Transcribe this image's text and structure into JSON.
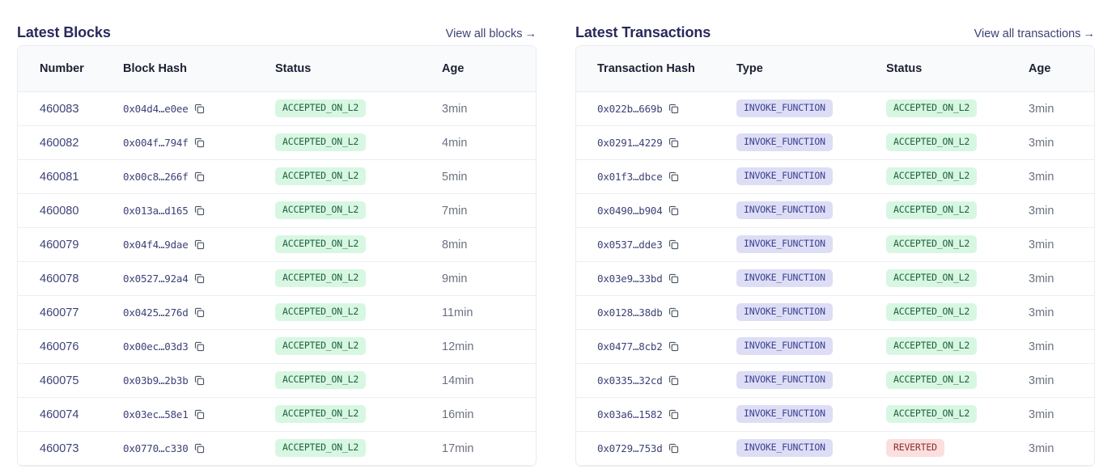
{
  "blocks_panel": {
    "title": "Latest Blocks",
    "view_all_label": "View all blocks",
    "view_all_arrow": "→",
    "columns": [
      "Number",
      "Block Hash",
      "Status",
      "Age"
    ],
    "rows": [
      {
        "number": "460083",
        "hash": "0x04d4…e0ee",
        "status": "ACCEPTED_ON_L2",
        "age": "3min"
      },
      {
        "number": "460082",
        "hash": "0x004f…794f",
        "status": "ACCEPTED_ON_L2",
        "age": "4min"
      },
      {
        "number": "460081",
        "hash": "0x00c8…266f",
        "status": "ACCEPTED_ON_L2",
        "age": "5min"
      },
      {
        "number": "460080",
        "hash": "0x013a…d165",
        "status": "ACCEPTED_ON_L2",
        "age": "7min"
      },
      {
        "number": "460079",
        "hash": "0x04f4…9dae",
        "status": "ACCEPTED_ON_L2",
        "age": "8min"
      },
      {
        "number": "460078",
        "hash": "0x0527…92a4",
        "status": "ACCEPTED_ON_L2",
        "age": "9min"
      },
      {
        "number": "460077",
        "hash": "0x0425…276d",
        "status": "ACCEPTED_ON_L2",
        "age": "11min"
      },
      {
        "number": "460076",
        "hash": "0x00ec…03d3",
        "status": "ACCEPTED_ON_L2",
        "age": "12min"
      },
      {
        "number": "460075",
        "hash": "0x03b9…2b3b",
        "status": "ACCEPTED_ON_L2",
        "age": "14min"
      },
      {
        "number": "460074",
        "hash": "0x03ec…58e1",
        "status": "ACCEPTED_ON_L2",
        "age": "16min"
      },
      {
        "number": "460073",
        "hash": "0x0770…c330",
        "status": "ACCEPTED_ON_L2",
        "age": "17min"
      }
    ]
  },
  "transactions_panel": {
    "title": "Latest Transactions",
    "view_all_label": "View all transactions",
    "view_all_arrow": "→",
    "columns": [
      "Transaction Hash",
      "Type",
      "Status",
      "Age"
    ],
    "rows": [
      {
        "hash": "0x022b…669b",
        "type": "INVOKE_FUNCTION",
        "status": "ACCEPTED_ON_L2",
        "age": "3min"
      },
      {
        "hash": "0x0291…4229",
        "type": "INVOKE_FUNCTION",
        "status": "ACCEPTED_ON_L2",
        "age": "3min"
      },
      {
        "hash": "0x01f3…dbce",
        "type": "INVOKE_FUNCTION",
        "status": "ACCEPTED_ON_L2",
        "age": "3min"
      },
      {
        "hash": "0x0490…b904",
        "type": "INVOKE_FUNCTION",
        "status": "ACCEPTED_ON_L2",
        "age": "3min"
      },
      {
        "hash": "0x0537…dde3",
        "type": "INVOKE_FUNCTION",
        "status": "ACCEPTED_ON_L2",
        "age": "3min"
      },
      {
        "hash": "0x03e9…33bd",
        "type": "INVOKE_FUNCTION",
        "status": "ACCEPTED_ON_L2",
        "age": "3min"
      },
      {
        "hash": "0x0128…38db",
        "type": "INVOKE_FUNCTION",
        "status": "ACCEPTED_ON_L2",
        "age": "3min"
      },
      {
        "hash": "0x0477…8cb2",
        "type": "INVOKE_FUNCTION",
        "status": "ACCEPTED_ON_L2",
        "age": "3min"
      },
      {
        "hash": "0x0335…32cd",
        "type": "INVOKE_FUNCTION",
        "status": "ACCEPTED_ON_L2",
        "age": "3min"
      },
      {
        "hash": "0x03a6…1582",
        "type": "INVOKE_FUNCTION",
        "status": "ACCEPTED_ON_L2",
        "age": "3min"
      },
      {
        "hash": "0x0729…753d",
        "type": "INVOKE_FUNCTION",
        "status": "REVERTED",
        "age": "3min"
      }
    ]
  },
  "icons": {
    "copy": "copy-icon"
  },
  "colors": {
    "title": "#29295c",
    "link": "#3d4277",
    "badge_accepted_bg": "#d7f7e2",
    "badge_accepted_text": "#1f5f3c",
    "badge_reverted_bg": "#fbdfdf",
    "badge_reverted_text": "#8d2d2d",
    "badge_invoke_bg": "#dddef5",
    "badge_invoke_text": "#3b3f91",
    "header_bg": "#f9fafb",
    "border": "#e9ebef",
    "age_text": "#6b7280"
  }
}
